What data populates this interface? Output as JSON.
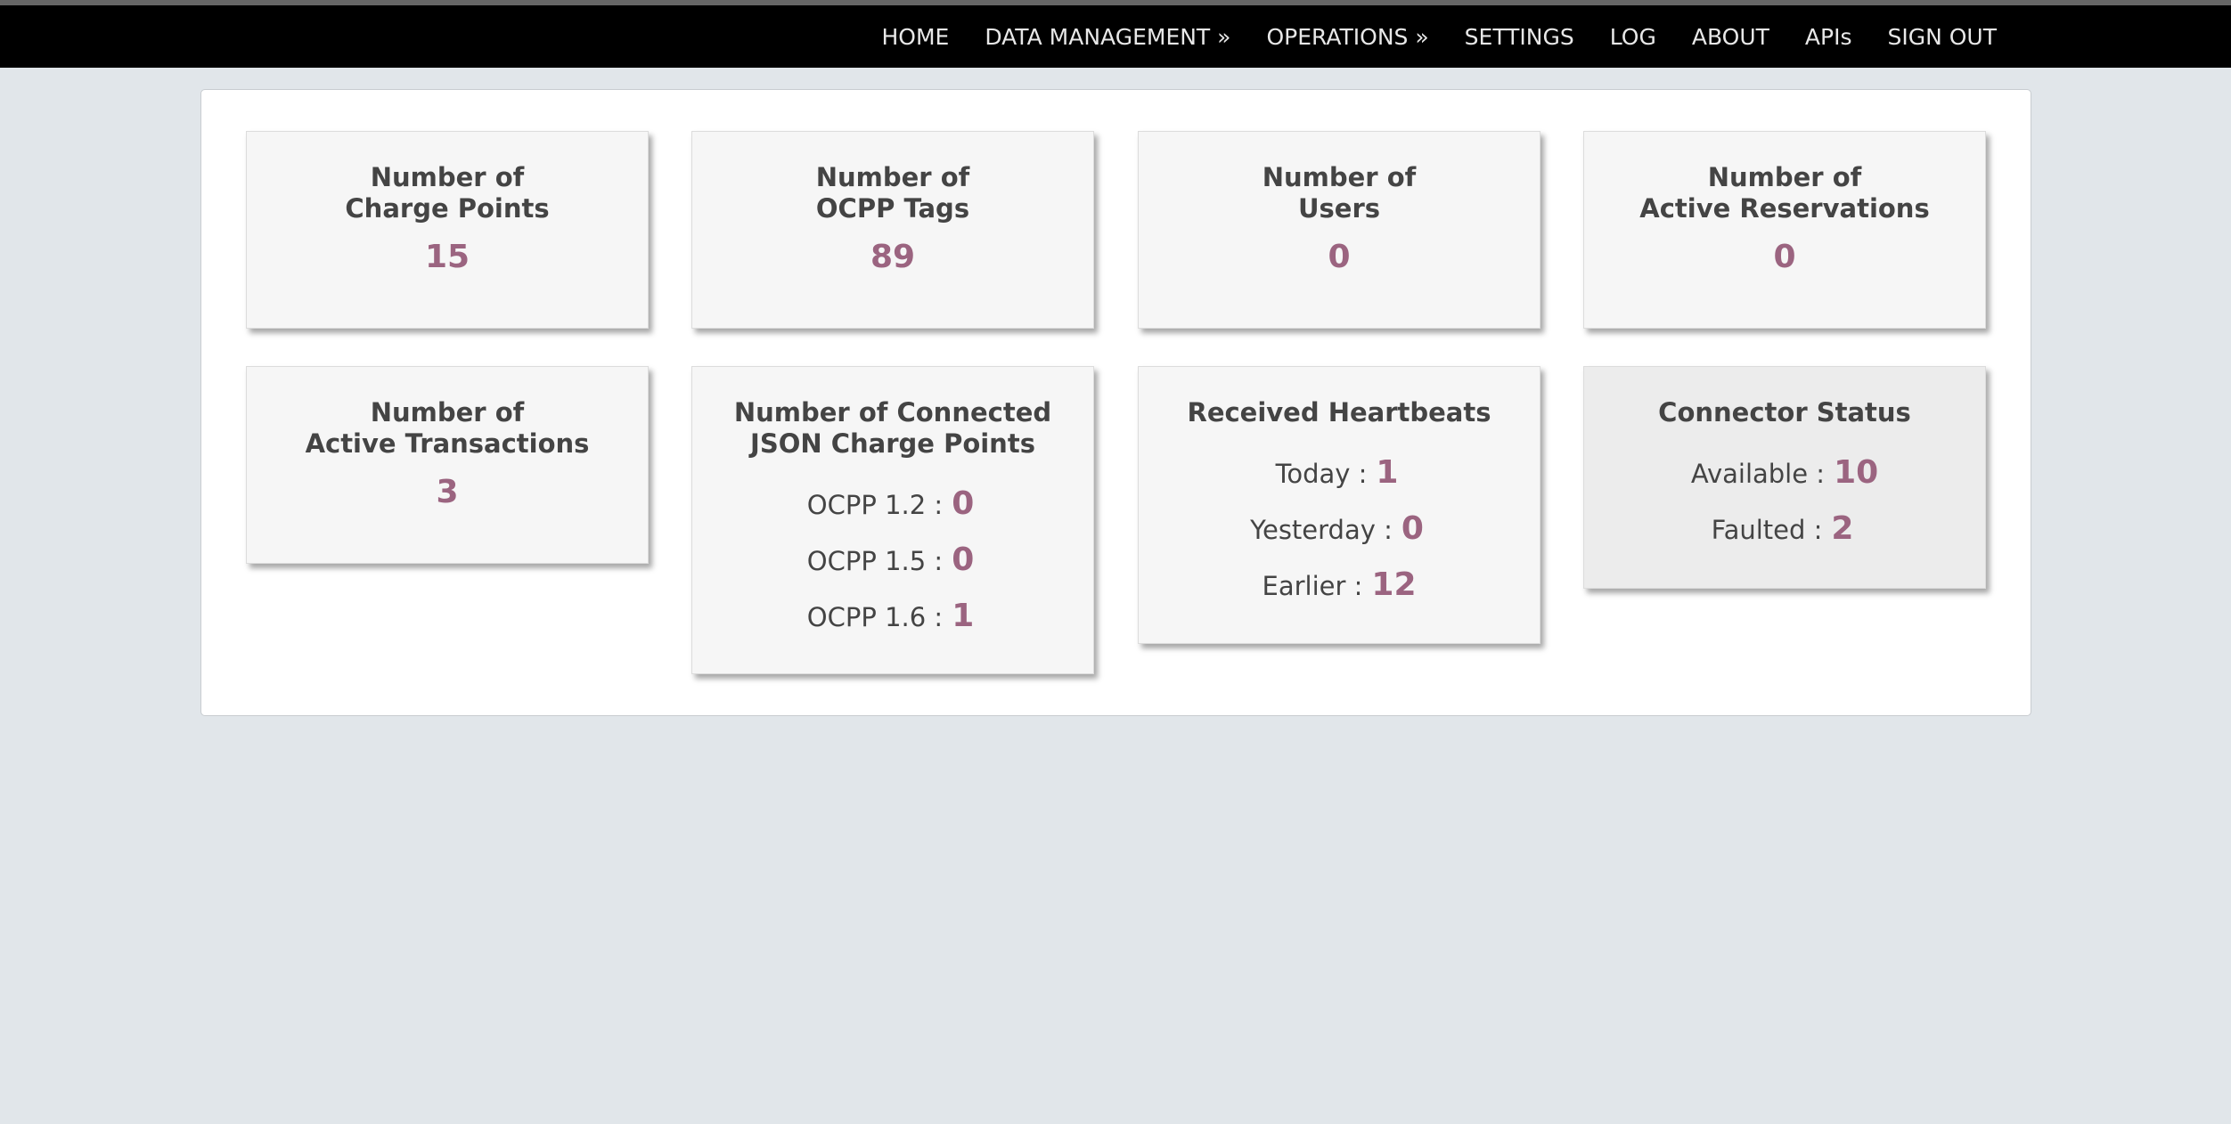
{
  "nav": {
    "items": [
      "HOME",
      "DATA MANAGEMENT »",
      "OPERATIONS »",
      "SETTINGS",
      "LOG",
      "ABOUT",
      "APIs",
      "SIGN OUT"
    ]
  },
  "tiles": {
    "charge_points": {
      "title_line1": "Number of",
      "title_line2": "Charge Points",
      "value": "15"
    },
    "ocpp_tags": {
      "title_line1": "Number of",
      "title_line2": "OCPP Tags",
      "value": "89"
    },
    "users": {
      "title_line1": "Number of",
      "title_line2": "Users",
      "value": "0"
    },
    "reservations": {
      "title_line1": "Number of",
      "title_line2": "Active Reservations",
      "value": "0"
    },
    "transactions": {
      "title_line1": "Number of",
      "title_line2": "Active Transactions",
      "value": "3"
    },
    "json_cps": {
      "title_line1": "Number of Connected",
      "title_line2": "JSON Charge Points",
      "rows": [
        {
          "label": "OCPP 1.2 :",
          "value": "0"
        },
        {
          "label": "OCPP 1.5 :",
          "value": "0"
        },
        {
          "label": "OCPP 1.6 :",
          "value": "1"
        }
      ]
    },
    "heartbeats": {
      "title": "Received Heartbeats",
      "rows": [
        {
          "label": "Today :",
          "value": "1"
        },
        {
          "label": "Yesterday :",
          "value": "0"
        },
        {
          "label": "Earlier :",
          "value": "12"
        }
      ]
    },
    "connector_status": {
      "title": "Connector Status",
      "rows": [
        {
          "label": "Available :",
          "value": "10"
        },
        {
          "label": "Faulted :",
          "value": "2"
        }
      ]
    }
  }
}
